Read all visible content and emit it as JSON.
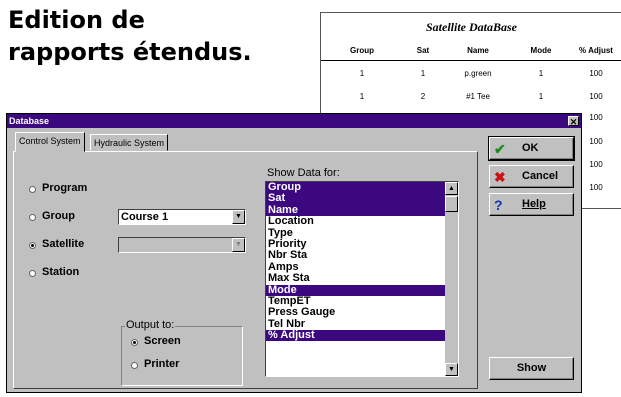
{
  "heading": {
    "line1": "Edition de",
    "line2": "rapports étendus."
  },
  "report": {
    "title": "Satellite DataBase",
    "columns": [
      "Group",
      "Sat",
      "Name",
      "Mode",
      "% Adjust"
    ],
    "rows": [
      [
        "1",
        "1",
        "p.green",
        "1",
        "100"
      ],
      [
        "1",
        "2",
        "#1 Tee",
        "1",
        "100"
      ],
      [
        "",
        "",
        "",
        "",
        "100"
      ],
      [
        "",
        "",
        "",
        "",
        "100"
      ],
      [
        "",
        "",
        "",
        "",
        "100"
      ],
      [
        "",
        "",
        "",
        "",
        "100"
      ]
    ]
  },
  "window": {
    "title": "Database",
    "close_glyph": "✕",
    "tabs": [
      "Control System",
      "Hydraulic System"
    ],
    "options": [
      {
        "label": "Program",
        "selected": false
      },
      {
        "label": "Group",
        "selected": false
      },
      {
        "label": "Satellite",
        "selected": true
      },
      {
        "label": "Station",
        "selected": false
      }
    ],
    "group_combo": {
      "value": "Course 1"
    },
    "satellite_combo": {
      "value": ""
    },
    "output": {
      "legend": "Output to:",
      "options": [
        {
          "label": "Screen",
          "selected": true
        },
        {
          "label": "Printer",
          "selected": false
        }
      ]
    },
    "show_data": {
      "label": "Show Data for:",
      "items": [
        {
          "label": "Group",
          "selected": true
        },
        {
          "label": "Sat",
          "selected": true
        },
        {
          "label": "Name",
          "selected": true
        },
        {
          "label": "Location",
          "selected": false
        },
        {
          "label": "Type",
          "selected": false
        },
        {
          "label": "Priority",
          "selected": false
        },
        {
          "label": "Nbr Sta",
          "selected": false
        },
        {
          "label": "Amps",
          "selected": false
        },
        {
          "label": "Max Sta",
          "selected": false
        },
        {
          "label": "Mode",
          "selected": true
        },
        {
          "label": "TempET",
          "selected": false
        },
        {
          "label": "Press Gauge",
          "selected": false
        },
        {
          "label": "Tel Nbr",
          "selected": false
        },
        {
          "label": "% Adjust",
          "selected": true
        }
      ]
    },
    "buttons": {
      "ok": {
        "label": "OK",
        "icon": "checkmark-icon",
        "color": "#1e8a1e"
      },
      "cancel": {
        "label": "Cancel",
        "icon": "x-icon",
        "color": "#c81414"
      },
      "help": {
        "label": "Help",
        "icon": "question-icon",
        "color": "#1432b4"
      },
      "show": {
        "label": "Show"
      }
    }
  }
}
